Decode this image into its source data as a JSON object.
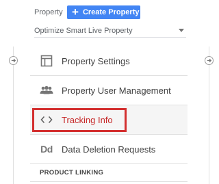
{
  "header": {
    "property_label": "Property",
    "create_button_label": "Create Property"
  },
  "property_select": {
    "value": "Optimize Smart Live Property"
  },
  "menu": {
    "items": [
      {
        "label": "Property Settings",
        "icon": "property-settings-icon"
      },
      {
        "label": "Property User Management",
        "icon": "users-icon"
      },
      {
        "label": "Tracking Info",
        "icon": "code-icon",
        "highlighted": true
      },
      {
        "label": "Data Deletion Requests",
        "icon": "data-deletion-icon",
        "icon_text": "Dd"
      }
    ],
    "section_heading": "PRODUCT LINKING"
  },
  "colors": {
    "accent": "#4285f4",
    "highlight": "#d32f2f"
  }
}
